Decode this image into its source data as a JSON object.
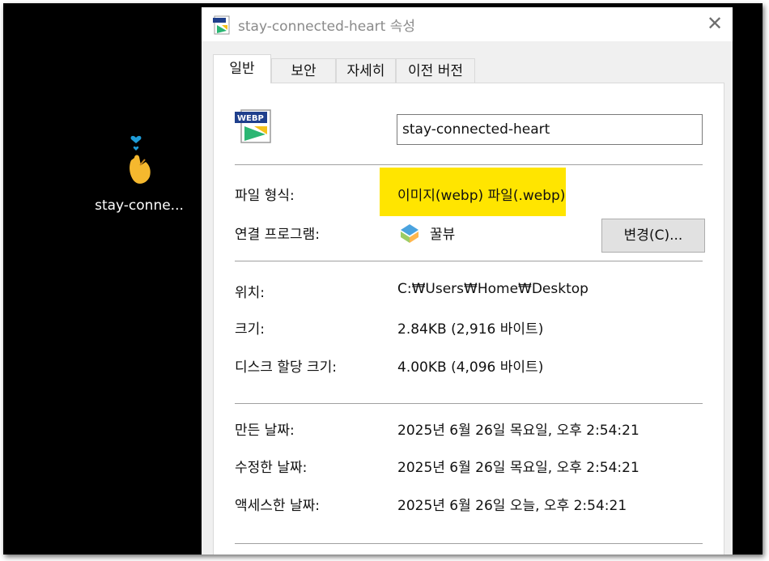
{
  "desktop": {
    "icon_label": "stay-conne..."
  },
  "window": {
    "title": "stay-connected-heart 속성",
    "close_glyph": "✕"
  },
  "tabs": [
    {
      "label": "일반",
      "active": true
    },
    {
      "label": "보안",
      "active": false
    },
    {
      "label": "자세히",
      "active": false
    },
    {
      "label": "이전 버전",
      "active": false
    }
  ],
  "file": {
    "icon_badge": "WEBP",
    "name": "stay-connected-heart"
  },
  "type": {
    "label": "파일 형식:",
    "value": "이미지(webp) 파일(.webp)"
  },
  "opens_with": {
    "label": "연결 프로그램:",
    "value": "꿀뷰",
    "change_button": "변경(C)..."
  },
  "location": {
    "label": "위치:",
    "value": "C:₩Users₩Home₩Desktop"
  },
  "size": {
    "label": "크기:",
    "value": "2.84KB (2,916 바이트)"
  },
  "size_on_disk": {
    "label": "디스크 할당 크기:",
    "value": "4.00KB (4,096 바이트)"
  },
  "created": {
    "label": "만든 날짜:",
    "value": "2025년 6월 26일 목요일, 오후 2:54:21"
  },
  "modified": {
    "label": "수정한 날짜:",
    "value": "2025년 6월 26일 목요일, 오후 2:54:21"
  },
  "accessed": {
    "label": "액세스한 날짜:",
    "value": "2025년 6월 26일 오늘, 오후 2:54:21"
  },
  "colors": {
    "highlight": "#ffe500",
    "heart_blue": "#1e9bd7",
    "hand": "#f5b82e"
  }
}
